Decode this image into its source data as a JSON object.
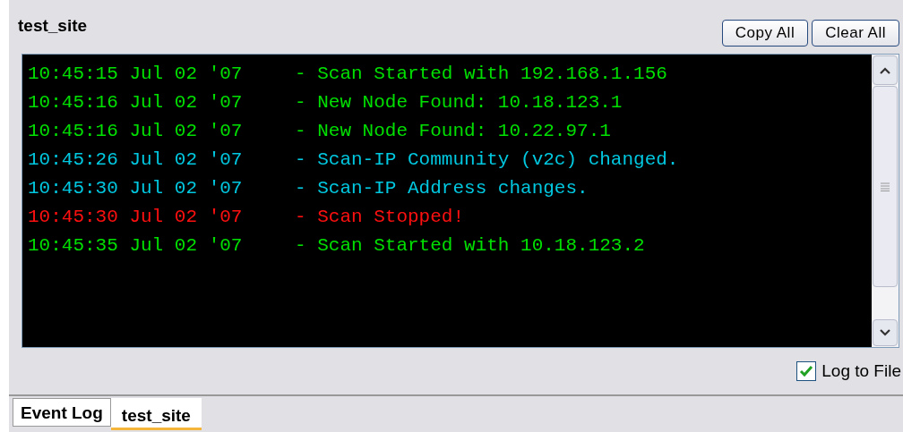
{
  "panel": {
    "title": "test_site",
    "buttons": [
      "Copy All",
      "Clear All"
    ]
  },
  "log": [
    {
      "time": "10:45:15 Jul 02 '07",
      "message": "- Scan Started with 192.168.1.156",
      "kind": "info"
    },
    {
      "time": "10:45:16 Jul 02 '07",
      "message": "- New Node Found: 10.18.123.1",
      "kind": "info"
    },
    {
      "time": "10:45:16 Jul 02 '07",
      "message": "- New Node Found: 10.22.97.1",
      "kind": "info"
    },
    {
      "time": "10:45:26 Jul 02 '07",
      "message": "- Scan-IP Community (v2c) changed.",
      "kind": "notice"
    },
    {
      "time": "10:45:30 Jul 02 '07",
      "message": "- Scan-IP Address changes.",
      "kind": "notice"
    },
    {
      "time": "10:45:30 Jul 02 '07",
      "message": "- Scan Stopped!",
      "kind": "error"
    },
    {
      "time": "10:45:35 Jul 02 '07",
      "message": "- Scan Started with 10.18.123.2",
      "kind": "info"
    }
  ],
  "log_to_file": {
    "label": "Log to File",
    "checked": true
  },
  "tabs": [
    {
      "label": "Event Log",
      "selected": false
    },
    {
      "label": "test_site",
      "selected": true
    }
  ]
}
